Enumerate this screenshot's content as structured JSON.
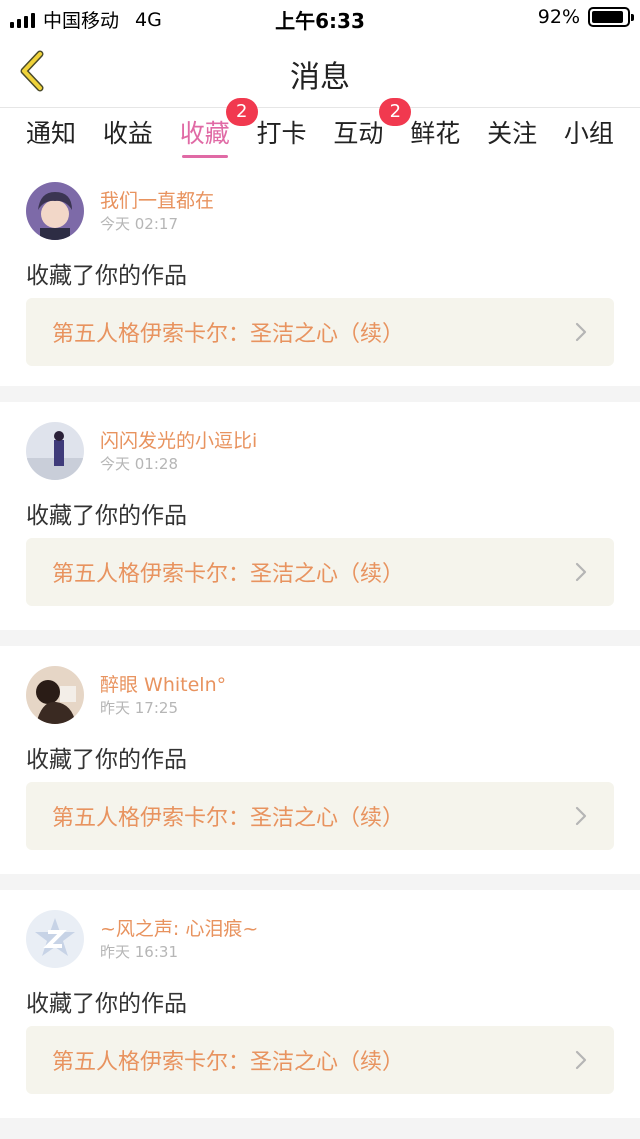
{
  "status_bar": {
    "carrier": "中国移动",
    "network": "4G",
    "time": "上午6:33",
    "battery": "92%",
    "battery_level": 0.92
  },
  "nav": {
    "title": "消息",
    "back_icon": "chevron-left-icon"
  },
  "tabs": [
    {
      "label": "通知",
      "badge": ""
    },
    {
      "label": "收益",
      "badge": ""
    },
    {
      "label": "收藏",
      "badge": "2",
      "active": true
    },
    {
      "label": "打卡",
      "badge": ""
    },
    {
      "label": "互动",
      "badge": "2"
    },
    {
      "label": "鲜花",
      "badge": ""
    },
    {
      "label": "关注",
      "badge": ""
    },
    {
      "label": "小组",
      "badge": ""
    }
  ],
  "colors": {
    "accent": "#e06aa5",
    "name": "#e8935f",
    "badge": "#f1394f",
    "link_bg": "#f5f4ec"
  },
  "messages": [
    {
      "user": "我们一直都在",
      "time": "今天 02:17",
      "action": "收藏了你的作品",
      "work": "第五人格伊索卡尔：圣洁之心（续）"
    },
    {
      "user": "闪闪发光的小逗比i",
      "time": "今天 01:28",
      "action": "收藏了你的作品",
      "work": "第五人格伊索卡尔：圣洁之心（续）"
    },
    {
      "user": "醉眼 Whiteln°",
      "time": "昨天 17:25",
      "action": "收藏了你的作品",
      "work": "第五人格伊索卡尔：圣洁之心（续）"
    },
    {
      "user": "~风之声: 心泪痕~",
      "time": "昨天 16:31",
      "action": "收藏了你的作品",
      "work": "第五人格伊索卡尔：圣洁之心（续）"
    }
  ]
}
